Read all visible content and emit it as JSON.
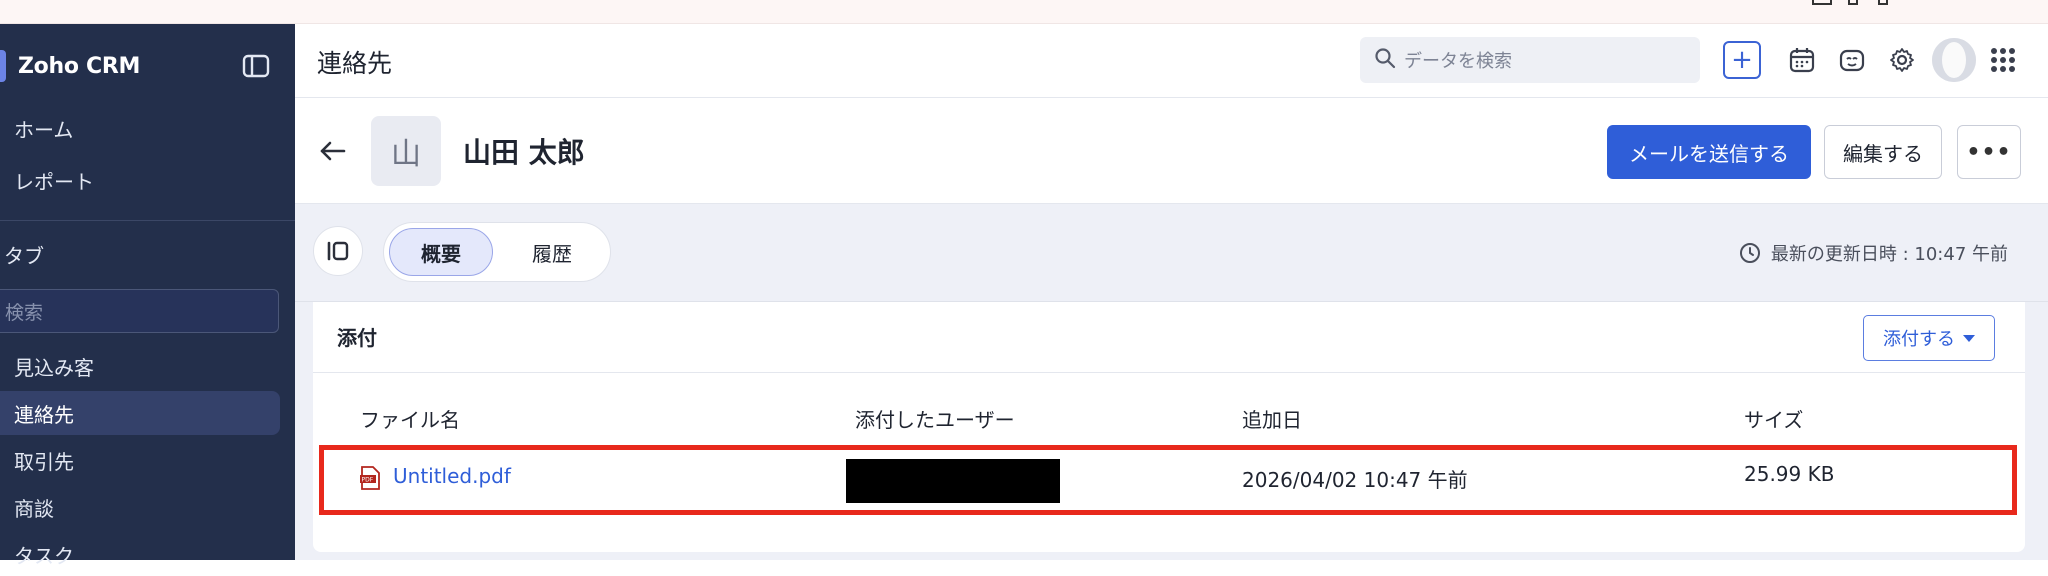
{
  "app": {
    "brand": "Zoho CRM",
    "accent_color": "#2f5ed8",
    "sidebar_color": "#232f4b",
    "highlight_color": "#e8291c"
  },
  "sidebar": {
    "top_items": [
      {
        "label": "ホーム"
      },
      {
        "label": "レポート"
      }
    ],
    "section_label": "タブ",
    "search_placeholder": "検索",
    "tab_items": [
      {
        "label": "見込み客"
      },
      {
        "label": "連絡先",
        "active": true
      },
      {
        "label": "取引先"
      },
      {
        "label": "商談"
      },
      {
        "label": "タスク"
      }
    ]
  },
  "header": {
    "title": "連絡先",
    "search_placeholder": "データを検索",
    "add_label": "+",
    "icons": [
      "calendar-icon",
      "bot-icon",
      "settings-icon",
      "profile-avatar",
      "apps-grid-icon"
    ]
  },
  "record": {
    "avatar_initial": "山",
    "name": "山田 太郎",
    "send_mail_label": "メールを送信する",
    "edit_label": "編集する",
    "more_label": "•••"
  },
  "tabs": {
    "items": [
      {
        "label": "概要",
        "active": true
      },
      {
        "label": "履歴"
      }
    ],
    "last_updated": "最新の更新日時 : 10:47 午前"
  },
  "attachments": {
    "title": "添付",
    "attach_button": "添付する",
    "columns": [
      "ファイル名",
      "添付したユーザー",
      "追加日",
      "サイズ"
    ],
    "rows": [
      {
        "file_name": "Untitled.pdf",
        "attached_by": "[redacted]",
        "added_date": "2026/04/02 10:47 午前",
        "size": "25.99 KB"
      }
    ]
  }
}
